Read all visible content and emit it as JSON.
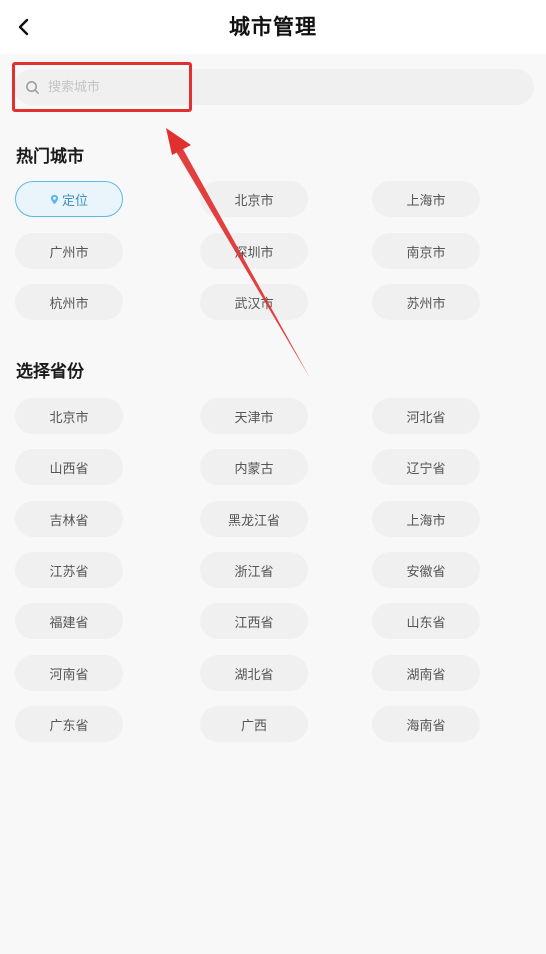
{
  "header": {
    "back_icon": "chevron-left-icon",
    "title": "城市管理"
  },
  "search": {
    "icon": "search-icon",
    "placeholder": "搜索城市"
  },
  "hot_cities": {
    "title": "热门城市",
    "locate_icon": "location-pin-icon",
    "locate_label": "定位",
    "items": [
      "北京市",
      "上海市",
      "广州市",
      "深圳市",
      "南京市",
      "杭州市",
      "武汉市",
      "苏州市"
    ]
  },
  "provinces": {
    "title": "选择省份",
    "items": [
      "北京市",
      "天津市",
      "河北省",
      "山西省",
      "内蒙古",
      "辽宁省",
      "吉林省",
      "黑龙江省",
      "上海市",
      "江苏省",
      "浙江省",
      "安徽省",
      "福建省",
      "江西省",
      "山东省",
      "河南省",
      "湖北省",
      "湖南省",
      "广东省",
      "广西",
      "海南省"
    ]
  },
  "colors": {
    "annotation": "#e03030",
    "locate_accent": "#5cb8e6"
  }
}
